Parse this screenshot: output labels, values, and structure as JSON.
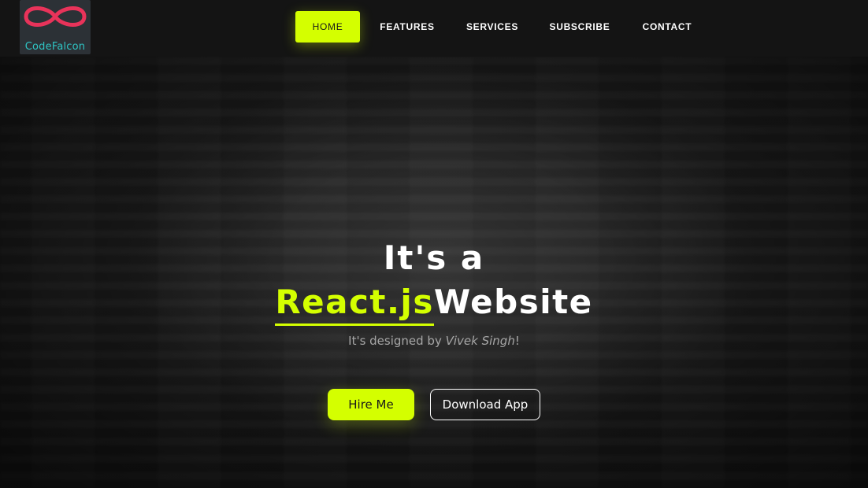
{
  "brand": {
    "logo_text": "CodeFalcon",
    "logo_icon": "infinity-icon",
    "logo_icon_color": "#e8335a",
    "logo_text_color": "#2ec4c4"
  },
  "nav": {
    "items": [
      {
        "label": "HOME",
        "active": true
      },
      {
        "label": "FEATURES",
        "active": false
      },
      {
        "label": "SERVICES",
        "active": false
      },
      {
        "label": "SUBSCRIBE",
        "active": false
      },
      {
        "label": "CONTACT",
        "active": false
      }
    ]
  },
  "hero": {
    "line1": "It's a",
    "accent_word": "React.js",
    "line2_rest": "Website",
    "subtitle_prefix": "It's designed by",
    "author": "Vivek Singh",
    "subtitle_suffix": "!"
  },
  "buttons": {
    "primary_label": "Hire Me",
    "secondary_label": "Download App"
  },
  "colors": {
    "accent": "#d4ff00",
    "background": "#141414",
    "text": "#ffffff",
    "muted": "#a6a6a6"
  }
}
